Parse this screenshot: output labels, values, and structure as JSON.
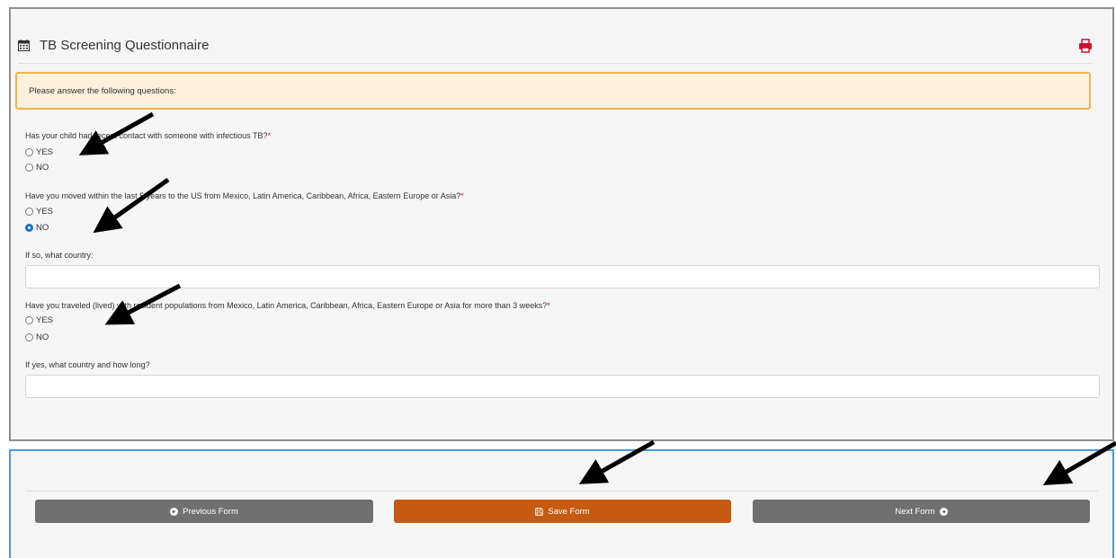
{
  "header": {
    "title": "TB Screening Questionnaire",
    "calendar_icon": "calendar-icon",
    "print_icon": "printer-icon",
    "print_color": "#c8102e"
  },
  "alert": {
    "text": "Please answer the following questions:"
  },
  "questions": [
    {
      "text": "Has your child had recent contact with someone with infectious TB?",
      "required": "*",
      "options": [
        {
          "label": "YES",
          "checked": false
        },
        {
          "label": "NO",
          "checked": false
        }
      ]
    },
    {
      "text": "Have you moved within the last 5 years to the US from Mexico, Latin America, Caribbean, Africa, Eastern Europe or Asia?",
      "required": "*",
      "options": [
        {
          "label": "YES",
          "checked": false
        },
        {
          "label": "NO",
          "checked": true
        }
      ]
    },
    {
      "text": "Have you traveled (lived) with resident populations from Mexico, Latin America, Caribbean, Africa, Eastern Europe or Asia for more than 3 weeks?",
      "required": "*",
      "options": [
        {
          "label": "YES",
          "checked": false
        },
        {
          "label": "NO",
          "checked": false
        }
      ]
    }
  ],
  "fields": {
    "country_label": "If so, what country:",
    "country_value": "",
    "travel_label": "If yes, what country and how long?",
    "travel_value": ""
  },
  "footer": {
    "prev_label": "Previous Form",
    "save_label": "Save Form",
    "next_label": "Next Form",
    "accent": "#c55a11",
    "neutral": "#707070"
  }
}
